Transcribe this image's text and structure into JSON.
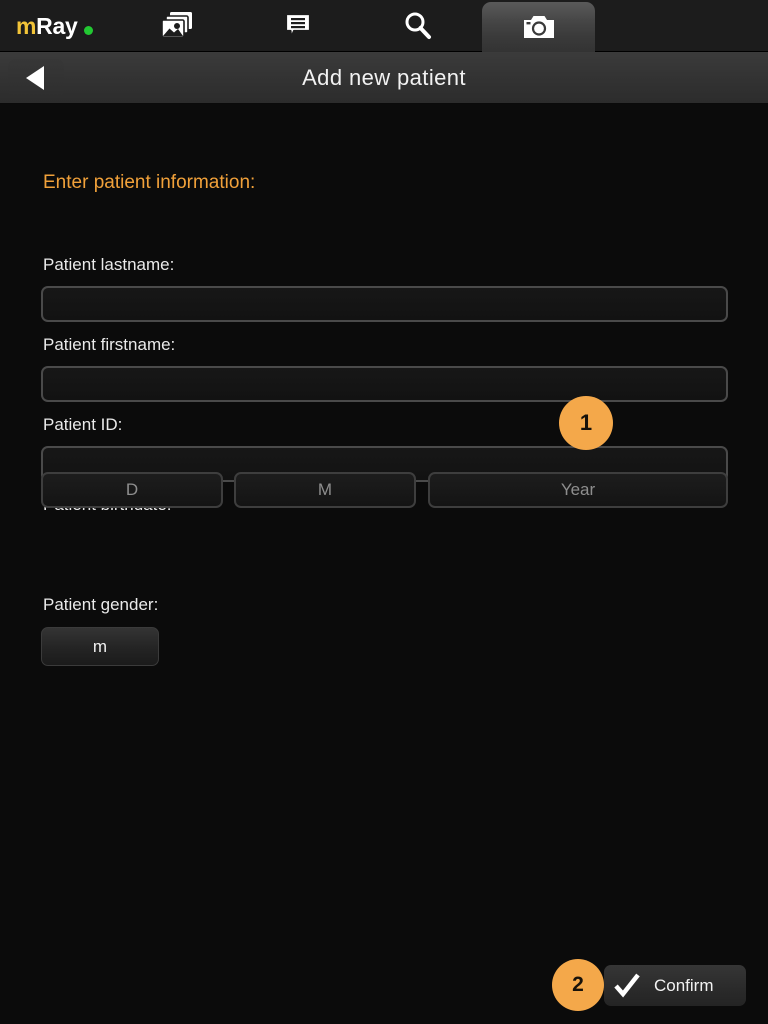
{
  "app": {
    "logo_m": "m",
    "logo_ray": "Ray",
    "status_dot_color": "#22c832",
    "accent_color": "#f1a13a",
    "badge_color": "#f4a84a"
  },
  "tabbar": {
    "tabs": [
      {
        "id": "images",
        "icon": "images-stack-icon",
        "active": false
      },
      {
        "id": "chat",
        "icon": "chat-bubble-icon",
        "active": false
      },
      {
        "id": "search",
        "icon": "search-icon",
        "active": false
      },
      {
        "id": "camera",
        "icon": "camera-icon",
        "active": true
      }
    ]
  },
  "header": {
    "title": "Add new patient",
    "back_icon": "back-arrow-icon"
  },
  "form": {
    "section_title": "Enter patient information:",
    "fields": [
      {
        "label": "Patient lastname:",
        "value": "",
        "placeholder": ""
      },
      {
        "label": "Patient firstname:",
        "value": "",
        "placeholder": ""
      },
      {
        "label": "Patient ID:",
        "value": "",
        "placeholder": ""
      }
    ],
    "birthdate": {
      "label": "Patient birthdate:",
      "day_placeholder": "D",
      "month_placeholder": "M",
      "year_placeholder": "Year"
    },
    "gender": {
      "label": "Patient gender:",
      "selected": "m"
    }
  },
  "badges": [
    {
      "id": "step-1",
      "text": "1"
    },
    {
      "id": "step-2",
      "text": "2"
    }
  ],
  "footer": {
    "confirm_label": "Confirm",
    "confirm_icon": "checkmark-icon"
  }
}
